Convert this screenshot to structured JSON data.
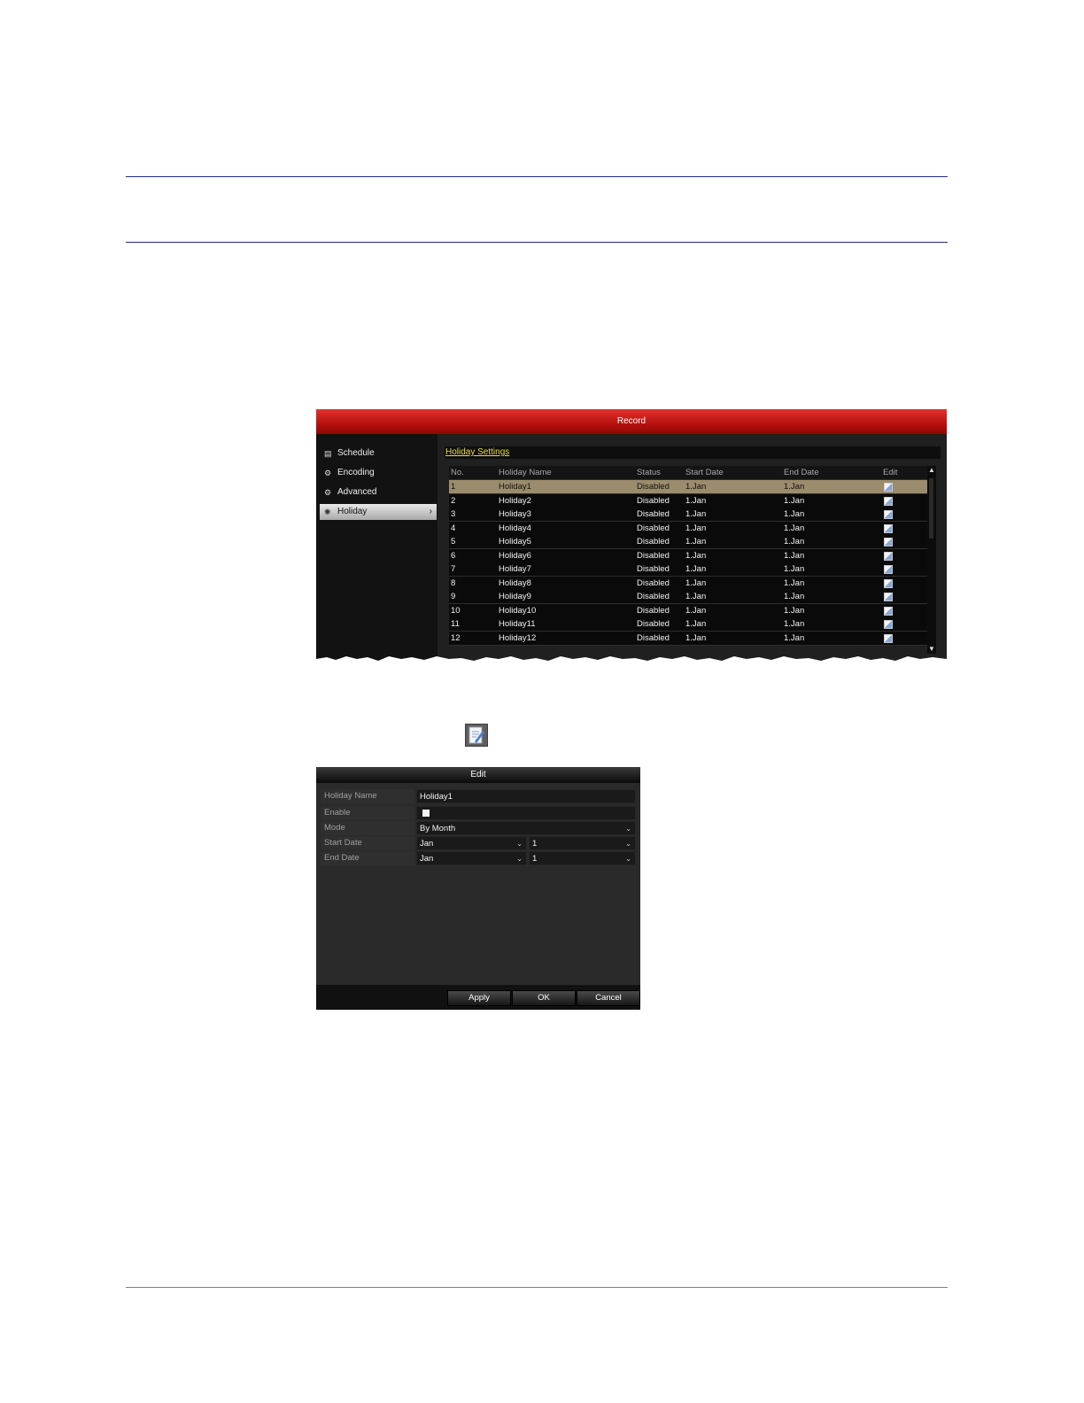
{
  "record_window": {
    "title": "Record",
    "sidebar": [
      {
        "label": "Schedule",
        "icon": "calendar-icon",
        "active": false
      },
      {
        "label": "Encoding",
        "icon": "gear-icon",
        "active": false
      },
      {
        "label": "Advanced",
        "icon": "gears-icon",
        "active": false
      },
      {
        "label": "Holiday",
        "icon": "holiday-icon",
        "active": true
      }
    ],
    "section_title": "Holiday Settings",
    "table": {
      "headers": [
        "No.",
        "Holiday Name",
        "Status",
        "Start Date",
        "End Date",
        "Edit"
      ],
      "rows": [
        [
          "1",
          "Holiday1",
          "Disabled",
          "1.Jan",
          "1.Jan"
        ],
        [
          "2",
          "Holiday2",
          "Disabled",
          "1.Jan",
          "1.Jan"
        ],
        [
          "3",
          "Holiday3",
          "Disabled",
          "1.Jan",
          "1.Jan"
        ],
        [
          "4",
          "Holiday4",
          "Disabled",
          "1.Jan",
          "1.Jan"
        ],
        [
          "5",
          "Holiday5",
          "Disabled",
          "1.Jan",
          "1.Jan"
        ],
        [
          "6",
          "Holiday6",
          "Disabled",
          "1.Jan",
          "1.Jan"
        ],
        [
          "7",
          "Holiday7",
          "Disabled",
          "1.Jan",
          "1.Jan"
        ],
        [
          "8",
          "Holiday8",
          "Disabled",
          "1.Jan",
          "1.Jan"
        ],
        [
          "9",
          "Holiday9",
          "Disabled",
          "1.Jan",
          "1.Jan"
        ],
        [
          "10",
          "Holiday10",
          "Disabled",
          "1.Jan",
          "1.Jan"
        ],
        [
          "11",
          "Holiday11",
          "Disabled",
          "1.Jan",
          "1.Jan"
        ],
        [
          "12",
          "Holiday12",
          "Disabled",
          "1.Jan",
          "1.Jan"
        ]
      ],
      "selected_row": 1
    },
    "colors": {
      "title_red": "#c41a16",
      "section_yellow": "#e8dc3a",
      "selected_row": "#9a8c6c"
    }
  },
  "edit_dialog": {
    "title": "Edit",
    "fields": {
      "holiday_name_label": "Holiday Name",
      "holiday_name_value": "Holiday1",
      "enable_label": "Enable",
      "mode_label": "Mode",
      "mode_value": "By Month",
      "start_date_label": "Start Date",
      "start_month": "Jan",
      "start_day": "1",
      "end_date_label": "End Date",
      "end_month": "Jan",
      "end_day": "1"
    },
    "buttons": {
      "apply": "Apply",
      "ok": "OK",
      "cancel": "Cancel"
    }
  }
}
